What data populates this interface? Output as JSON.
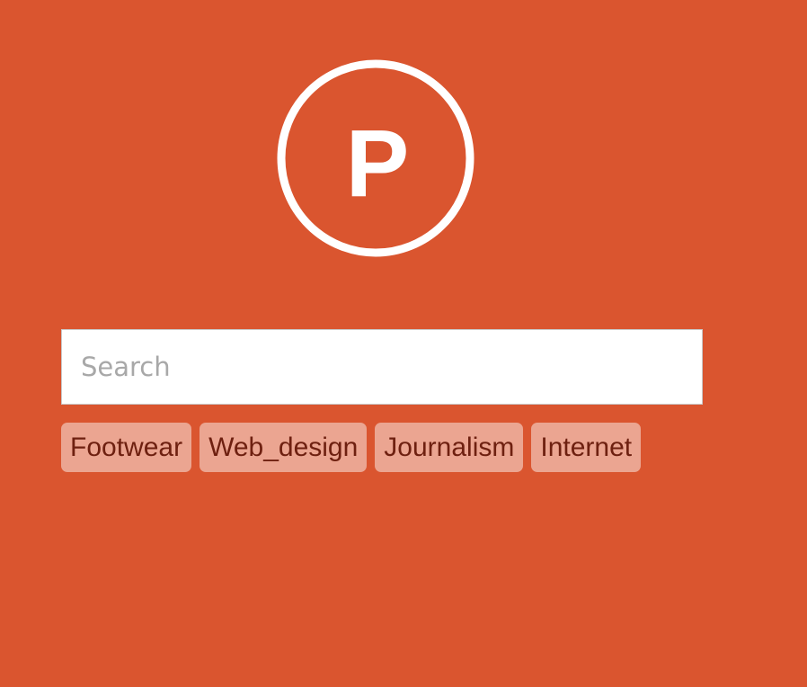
{
  "logo": {
    "letter": "P",
    "icon": "product-hunt-logo-icon"
  },
  "search": {
    "placeholder": "Search",
    "value": ""
  },
  "tags": [
    {
      "label": "Footwear"
    },
    {
      "label": "Web_design"
    },
    {
      "label": "Journalism"
    },
    {
      "label": "Internet"
    }
  ],
  "colors": {
    "background": "#DA552F",
    "tag_background": "#EBA591",
    "tag_text": "#6E2010",
    "logo_stroke": "#FFFFFF",
    "search_background": "#FFFFFF",
    "placeholder": "#A8A8A8"
  }
}
